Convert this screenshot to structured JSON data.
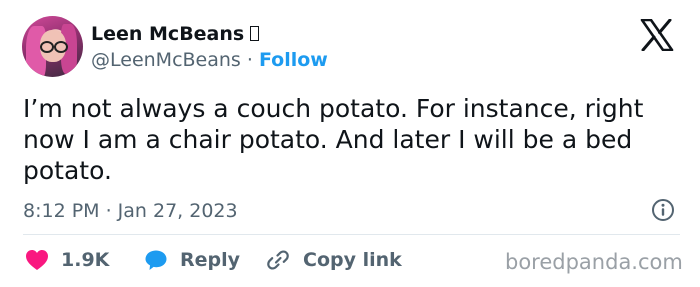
{
  "author": {
    "name": "Leen McBeans",
    "handle": "@LeenMcBeans",
    "separator": "·",
    "follow_label": "Follow"
  },
  "tweet": {
    "text": "I’m not always a couch potato. For instance, right now I am a chair potato. And later I will be a bed potato.",
    "timestamp": "8:12 PM · Jan 27, 2023"
  },
  "actions": {
    "like_count": "1.9K",
    "reply_label": "Reply",
    "copy_link_label": "Copy link"
  },
  "watermark": "boredpanda.com",
  "icons": {
    "logo": "x-logo-icon",
    "info": "info-icon",
    "like": "heart-icon",
    "reply": "speech-bubble-icon",
    "copy": "link-icon"
  },
  "colors": {
    "accent": "#1d9bf0",
    "like": "#f91880",
    "text": "#0f1419",
    "muted": "#536471"
  }
}
